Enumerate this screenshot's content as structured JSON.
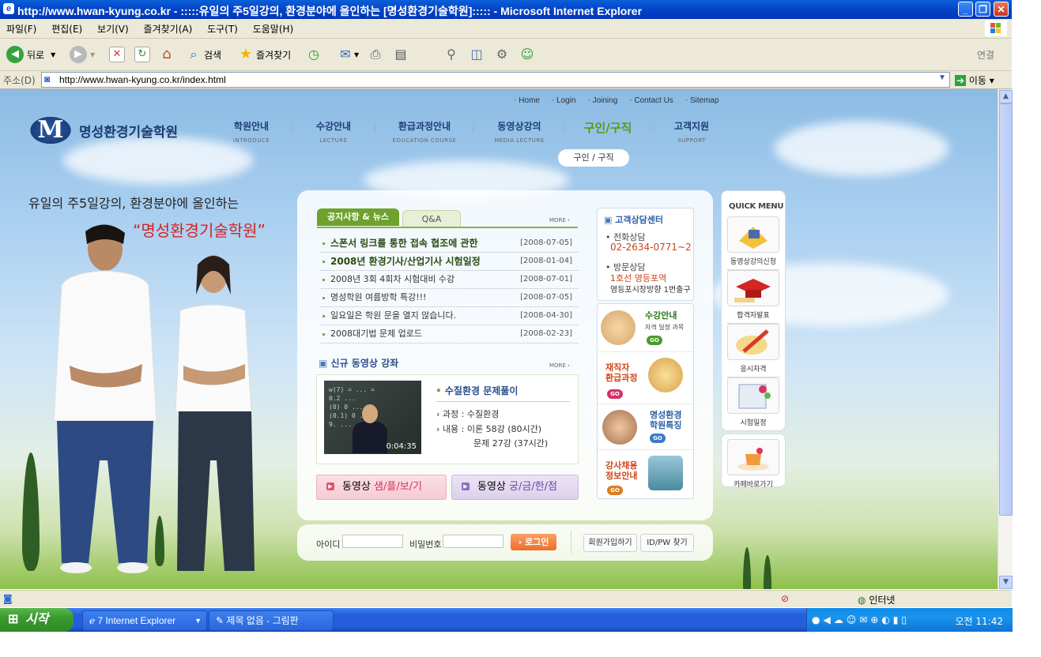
{
  "window": {
    "title": "http://www.hwan-kyung.co.kr - :::::유일의 주5일강의, 환경분야에 올인하는 [명성환경기술학원]::::: - Microsoft Internet Explorer",
    "minimize": "_",
    "maximize": "❐",
    "close": "✕"
  },
  "menubar": [
    "파일(F)",
    "편집(E)",
    "보기(V)",
    "즐겨찾기(A)",
    "도구(T)",
    "도움말(H)"
  ],
  "toolbar": {
    "back": "뒤로",
    "search": "검색",
    "favorites": "즐겨찾기",
    "links": "연결"
  },
  "address": {
    "label": "주소(D)",
    "url": "http://www.hwan-kyung.co.kr/index.html",
    "go": "이동"
  },
  "site": {
    "topnav": [
      "Home",
      "Login",
      "Joining",
      "Contact Us",
      "Sitemap"
    ],
    "logo_mark": "M",
    "logo_name": "명성환경기술학원",
    "gnb": [
      {
        "ko": "학원안내",
        "en": "INTRODUCE"
      },
      {
        "ko": "수강안내",
        "en": "LECTURE"
      },
      {
        "ko": "환급과정안내",
        "en": "EDUCATION COURSE"
      },
      {
        "ko": "동영상강의",
        "en": "MEDIA LECTURE"
      },
      {
        "ko": "구인/구직",
        "en": ""
      },
      {
        "ko": "고객지원",
        "en": "SUPPORT"
      }
    ],
    "subnav": "구인  /  구직",
    "slogan_line1": "유일의 주5일강의, 환경분야에 올인하는",
    "slogan_line2": "“명성환경기술학원”",
    "tabs": {
      "notice": "공지사항 & 뉴스",
      "qa": "Q&A"
    },
    "more": "MORE ›",
    "notices": [
      {
        "title": "스폰서 링크를 통한 접속 협조에 관한",
        "date": "[2008-07-05]"
      },
      {
        "title": "2008년 환경기사/산업기사 시험일정",
        "date": "[2008-01-04]"
      },
      {
        "title": "2008년 3회 4회차 시험대비 수강",
        "date": "[2008-07-01]"
      },
      {
        "title": "명성학원 여름방학 특강!!!",
        "date": "[2008-07-05]"
      },
      {
        "title": "일요일은 학원 문을 열지 않습니다.",
        "date": "[2008-04-30]"
      },
      {
        "title": "2008대기법 문제 업로드",
        "date": "[2008-02-23]"
      }
    ],
    "video": {
      "section_title": "신규 동영상 강좌",
      "name": "수질환경 문제풀이",
      "course_label": "과정 :",
      "course": "수질환경",
      "content_label": "내용 :",
      "content1": "이론 58강 (80시간)",
      "content2": "문제 27강 (37시간)",
      "time": "0:04:35"
    },
    "video_btn1": {
      "prefix": "동영상 ",
      "hl": "샘/플/보/기"
    },
    "video_btn2": {
      "prefix": "동영상 ",
      "hl": "궁/금/한/점"
    },
    "cs": {
      "title": "고객상담센터",
      "phone_label": "전화상담",
      "phone": "02-2634-0771~2",
      "visit_label": "방문상담",
      "visit1": "1호선 영등포역",
      "visit2": "영등포시장방향 1번출구"
    },
    "promos": [
      {
        "title": "수강안내",
        "sub": "자격 일정 과목"
      },
      {
        "title": "재직자\n환급과정",
        "sub": ""
      },
      {
        "title": "명성환경\n학원특징",
        "sub": ""
      },
      {
        "title": "강사채용\n정보안내",
        "sub": ""
      }
    ],
    "go": "GO",
    "quick_title": "QUICK MENU",
    "quick": [
      "동영상강의신청",
      "합격자발표",
      "응시자격",
      "시험일정",
      "카페바로가기"
    ],
    "login": {
      "id_label": "아이디",
      "pw_label": "비밀번호",
      "login": "› 로그인",
      "join": "회원가입하기",
      "find": "ID/PW 찾기"
    }
  },
  "statusbar": {
    "zone": "인터넷"
  },
  "taskbar": {
    "start": "시작",
    "ie": "7 Internet Explorer",
    "paint": "제목 없음 - 그림판",
    "clock": "오전 11:42"
  },
  "colors": {
    "title_bar": "#0344c9",
    "accent_green": "#6ea22c",
    "accent_red": "#d42424",
    "navy": "#1d3e76"
  }
}
